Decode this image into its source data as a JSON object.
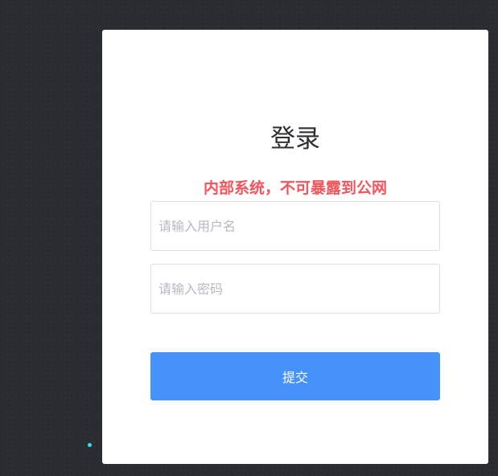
{
  "login": {
    "title": "登录",
    "warning": "内部系统，不可暴露到公网",
    "username": {
      "value": "",
      "placeholder": "请输入用户名"
    },
    "password": {
      "value": "",
      "placeholder": "请输入密码"
    },
    "submit_label": "提交"
  },
  "colors": {
    "background": "#2b2c31",
    "card": "#ffffff",
    "warning": "#f4545c",
    "primary": "#4692fb",
    "accent_dot": "#2ee3f5"
  }
}
